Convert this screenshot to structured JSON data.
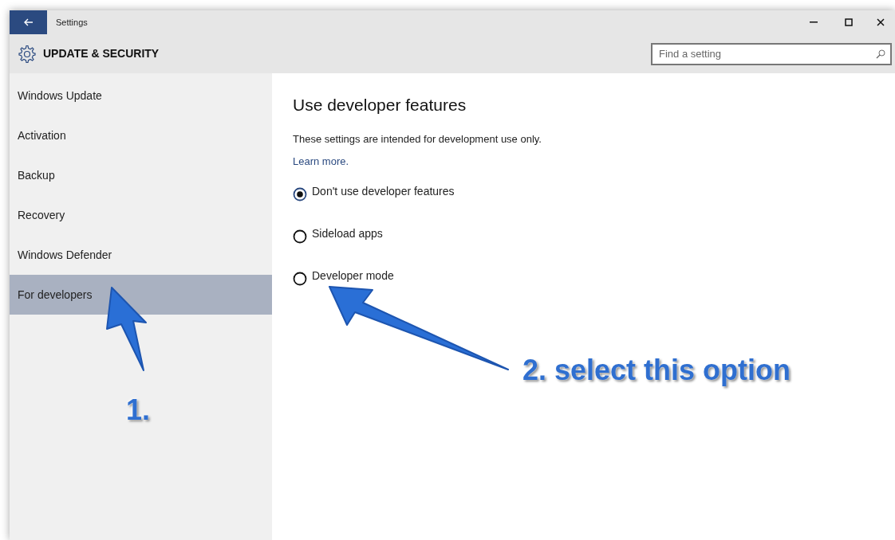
{
  "window": {
    "title": "Settings"
  },
  "header": {
    "title": "UPDATE & SECURITY",
    "search": {
      "placeholder": "Find a setting"
    }
  },
  "sidebar": {
    "items": [
      {
        "label": "Windows Update",
        "selected": false
      },
      {
        "label": "Activation",
        "selected": false
      },
      {
        "label": "Backup",
        "selected": false
      },
      {
        "label": "Recovery",
        "selected": false
      },
      {
        "label": "Windows Defender",
        "selected": false
      },
      {
        "label": "For developers",
        "selected": true
      }
    ]
  },
  "content": {
    "heading": "Use developer features",
    "description": "These settings are intended for development use only.",
    "link": "Learn more.",
    "options": [
      {
        "label": "Don't use developer features",
        "selected": true
      },
      {
        "label": "Sideload apps",
        "selected": false
      },
      {
        "label": "Developer mode",
        "selected": false
      }
    ]
  },
  "annotations": [
    {
      "label": "1."
    },
    {
      "label": "2. select this option"
    }
  ]
}
